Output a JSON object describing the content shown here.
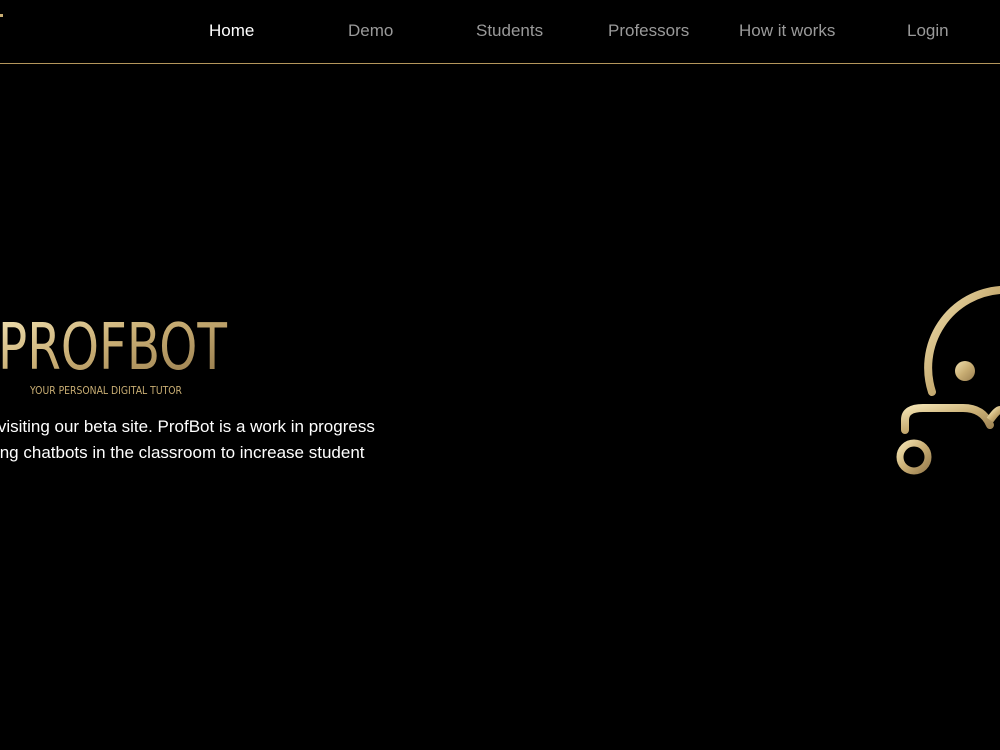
{
  "nav": {
    "items": [
      {
        "id": "nav-home",
        "label": "Home",
        "active": true
      },
      {
        "id": "nav-demo",
        "label": "Demo",
        "active": false
      },
      {
        "id": "nav-students",
        "label": "Students",
        "active": false
      },
      {
        "id": "nav-professors",
        "label": "Professors",
        "active": false
      },
      {
        "id": "nav-how",
        "label": "How it works",
        "active": false
      },
      {
        "id": "nav-login",
        "label": "Login",
        "active": false
      }
    ]
  },
  "hero": {
    "logo_text": "PROFBOT",
    "tagline": "YOUR PERSONAL DIGITAL TUTOR",
    "intro_line_1": "or visiting our beta site. ProfBot is a work in progress",
    "intro_line_2": "using chatbots in the classroom to increase student"
  },
  "colors": {
    "background": "#000000",
    "accent_gold": "#c8ad73",
    "nav_active": "#ffffff",
    "nav_inactive": "#9a9a9a"
  },
  "icons": {
    "bot_mark": "profbot-robot-icon"
  }
}
